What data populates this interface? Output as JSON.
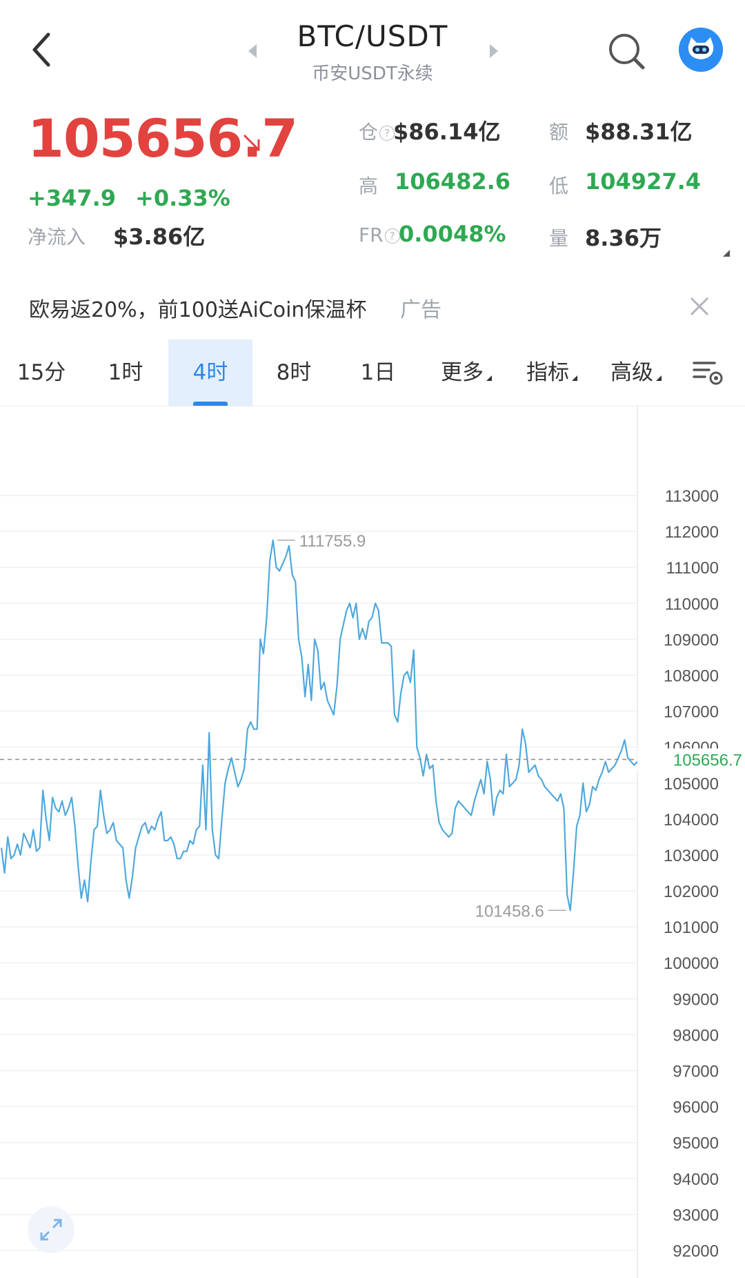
{
  "header": {
    "title": "BTC/USDT",
    "subtitle": "币安USDT永续",
    "icons": [
      "back-icon",
      "prev-arrow-icon",
      "next-arrow-icon",
      "search-icon",
      "avatar-icon"
    ]
  },
  "ticker": {
    "price": "105656.7",
    "change": "+347.9",
    "change_pct": "+0.33%",
    "net_inflow_label": "净流入",
    "net_inflow_value": "$3.86亿",
    "open_interest_label": "仓",
    "open_interest_value": "$86.14亿",
    "turnover_label": "额",
    "turnover_value": "$88.31亿",
    "high_label": "高",
    "high_value": "106482.6",
    "low_label": "低",
    "low_value": "104927.4",
    "funding_label": "FR",
    "funding_value": "0.0048%",
    "volume_label": "量",
    "volume_value": "8.36万"
  },
  "ad": {
    "text": "欧易返20%，前100送AiCoin保温杯",
    "tag": "广告"
  },
  "tabs": [
    {
      "label": "15分"
    },
    {
      "label": "1时"
    },
    {
      "label": "4时",
      "active": true
    },
    {
      "label": "8时"
    },
    {
      "label": "1日"
    },
    {
      "label": "更多"
    },
    {
      "label": "指标"
    },
    {
      "label": "高级"
    }
  ],
  "colors": {
    "up": "#2ea952",
    "down": "#e2433e",
    "accent": "#2f86e8",
    "line": "#4fa8dc"
  },
  "chart_data": {
    "type": "line",
    "ylim": [
      92000,
      113000
    ],
    "yticks": [
      113000,
      112000,
      111000,
      110000,
      109000,
      108000,
      107000,
      106000,
      105000,
      104000,
      103000,
      102000,
      101000,
      100000,
      99000,
      98000,
      97000,
      96000,
      95000,
      94000,
      93000,
      92000
    ],
    "current_price": 105656.7,
    "current_label": "105656.7",
    "max_label": "111755.9",
    "min_label": "101458.6",
    "values": [
      103200,
      102500,
      103500,
      102900,
      103000,
      103300,
      103000,
      103600,
      103400,
      103200,
      103700,
      103100,
      103200,
      104800,
      104000,
      103400,
      104600,
      104300,
      104200,
      104500,
      104100,
      104300,
      104600,
      103800,
      102700,
      101800,
      102300,
      101700,
      102800,
      103700,
      103800,
      104800,
      104100,
      103600,
      103700,
      103900,
      103400,
      103300,
      103200,
      102300,
      101800,
      102400,
      103200,
      103500,
      103800,
      103900,
      103600,
      103800,
      103700,
      104000,
      104200,
      103400,
      103400,
      103500,
      103300,
      102900,
      102900,
      103100,
      103100,
      103400,
      103300,
      103700,
      103800,
      105500,
      103700,
      106400,
      103700,
      103000,
      102900,
      104000,
      105000,
      105400,
      105700,
      105300,
      104900,
      105100,
      105400,
      106500,
      106700,
      106500,
      106500,
      109000,
      108600,
      109600,
      111200,
      111755.9,
      111000,
      110900,
      111100,
      111300,
      111600,
      110800,
      110600,
      109000,
      108500,
      107400,
      108300,
      107300,
      109000,
      108700,
      107600,
      107800,
      107300,
      107100,
      106900,
      107700,
      109000,
      109400,
      109800,
      110000,
      109600,
      110000,
      109000,
      109300,
      109000,
      109500,
      109600,
      110000,
      109800,
      108900,
      108900,
      108900,
      108800,
      106900,
      106700,
      107500,
      108000,
      108100,
      107800,
      108700,
      106000,
      105700,
      105200,
      105800,
      105400,
      105500,
      104500,
      103900,
      103700,
      103600,
      103500,
      103600,
      104300,
      104500,
      104400,
      104300,
      104200,
      104100,
      104500,
      104800,
      105100,
      104700,
      105600,
      105100,
      104100,
      104600,
      104800,
      104700,
      105800,
      104900,
      105000,
      105100,
      105500,
      106500,
      106100,
      105300,
      105400,
      105500,
      105200,
      105100,
      104900,
      104800,
      104700,
      104600,
      104500,
      104700,
      104300,
      101900,
      101458.6,
      102500,
      103800,
      104100,
      105000,
      104200,
      104400,
      104900,
      104800,
      105100,
      105300,
      105600,
      105300,
      105400,
      105500,
      105700,
      105900,
      106200,
      105700,
      105600,
      105500,
      105600
    ]
  }
}
